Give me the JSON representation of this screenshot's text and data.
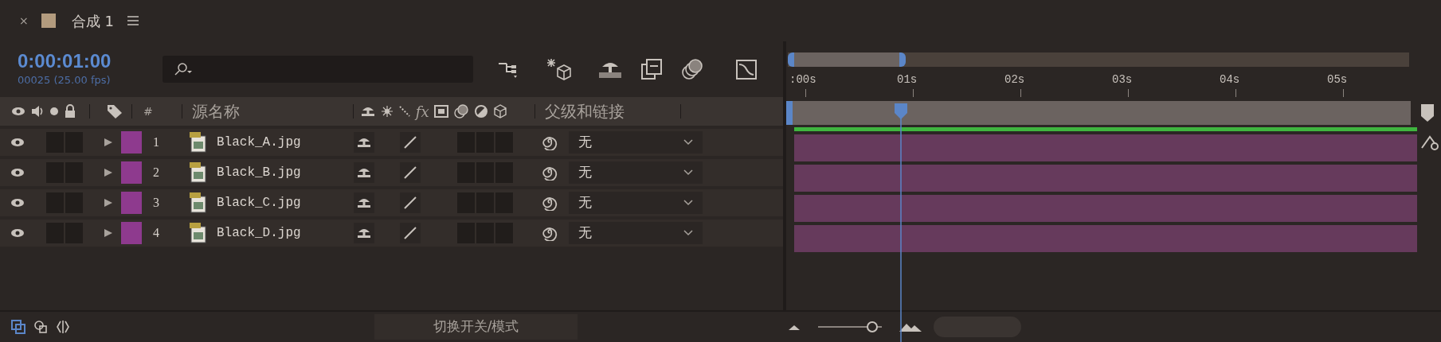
{
  "panel_tab": {
    "close_glyph": "×",
    "title": "合成 1"
  },
  "timecode": "0:00:01:00",
  "frame_info": "00025 (25.00 fps)",
  "columns": {
    "number": "#",
    "source_name": "源名称",
    "fx": "fx",
    "parent": "父级和链接"
  },
  "layers": [
    {
      "number": "1",
      "name": "Black_A.jpg",
      "parent": "无",
      "color": "#8e3a8e",
      "visible": true,
      "audio": false,
      "solo": false
    },
    {
      "number": "2",
      "name": "Black_B.jpg",
      "parent": "无",
      "color": "#8e3a8e",
      "visible": true,
      "audio": false,
      "solo": false
    },
    {
      "number": "3",
      "name": "Black_C.jpg",
      "parent": "无",
      "color": "#8e3a8e",
      "visible": true,
      "audio": false,
      "solo": false
    },
    {
      "number": "4",
      "name": "Black_D.jpg",
      "parent": "无",
      "color": "#8e3a8e",
      "visible": true,
      "audio": false,
      "solo": false
    }
  ],
  "timeline": {
    "navigator": {
      "level": 0.19
    },
    "ruler_labels": [
      ":00s",
      "01s",
      "02s",
      "03s",
      "04s",
      "05s"
    ],
    "playhead": {
      "level": 0.172
    }
  },
  "bottom_bar": {
    "toggle_label": "切换开关/模式",
    "zoom": {
      "level": 0.85
    }
  }
}
